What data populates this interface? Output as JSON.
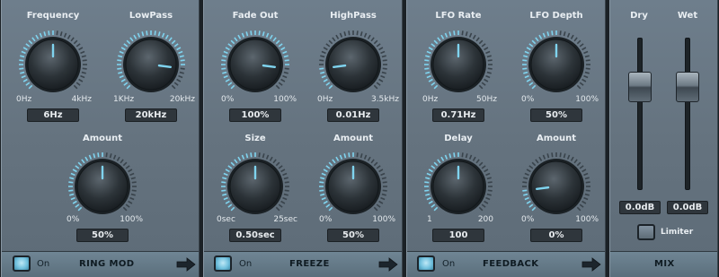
{
  "colors": {
    "accent": "#7fd3ee",
    "knob_body": "#2c3338",
    "panel": "#66747f"
  },
  "sections": [
    {
      "id": "ring-mod",
      "title": "RING MOD",
      "on_label": "On",
      "knobs": [
        {
          "label": "Frequency",
          "min": "0Hz",
          "max": "4kHz",
          "value": "6Hz",
          "level": 0.5
        },
        {
          "label": "LowPass",
          "min": "1KHz",
          "max": "20kHz",
          "value": "20kHz",
          "level": 0.86
        },
        {
          "label": "Amount",
          "min": "0%",
          "max": "100%",
          "value": "50%",
          "level": 0.5
        }
      ]
    },
    {
      "id": "freeze",
      "title": "FREEZE",
      "on_label": "On",
      "knobs": [
        {
          "label": "Fade Out",
          "min": "0%",
          "max": "100%",
          "value": "100%",
          "level": 0.86
        },
        {
          "label": "HighPass",
          "min": "0Hz",
          "max": "3.5kHz",
          "value": "0.01Hz",
          "level": 0.14
        },
        {
          "label": "Size",
          "min": "0sec",
          "max": "25sec",
          "value": "0.50sec",
          "level": 0.5
        },
        {
          "label": "Amount",
          "min": "0%",
          "max": "100%",
          "value": "50%",
          "level": 0.5
        }
      ]
    },
    {
      "id": "feedback",
      "title": "FEEDBACK",
      "on_label": "On",
      "knobs": [
        {
          "label": "LFO Rate",
          "min": "0Hz",
          "max": "50Hz",
          "value": "0.71Hz",
          "level": 0.5
        },
        {
          "label": "LFO Depth",
          "min": "0%",
          "max": "100%",
          "value": "50%",
          "level": 0.5
        },
        {
          "label": "Delay",
          "min": "1",
          "max": "200",
          "value": "100",
          "level": 0.5
        },
        {
          "label": "Amount",
          "min": "0%",
          "max": "100%",
          "value": "0%",
          "level": 0.14
        }
      ]
    }
  ],
  "mix": {
    "title": "MIX",
    "dry": {
      "label": "Dry",
      "value": "0.0dB",
      "level": 0.72
    },
    "wet": {
      "label": "Wet",
      "value": "0.0dB",
      "level": 0.72
    },
    "limiter_label": "Limiter"
  }
}
